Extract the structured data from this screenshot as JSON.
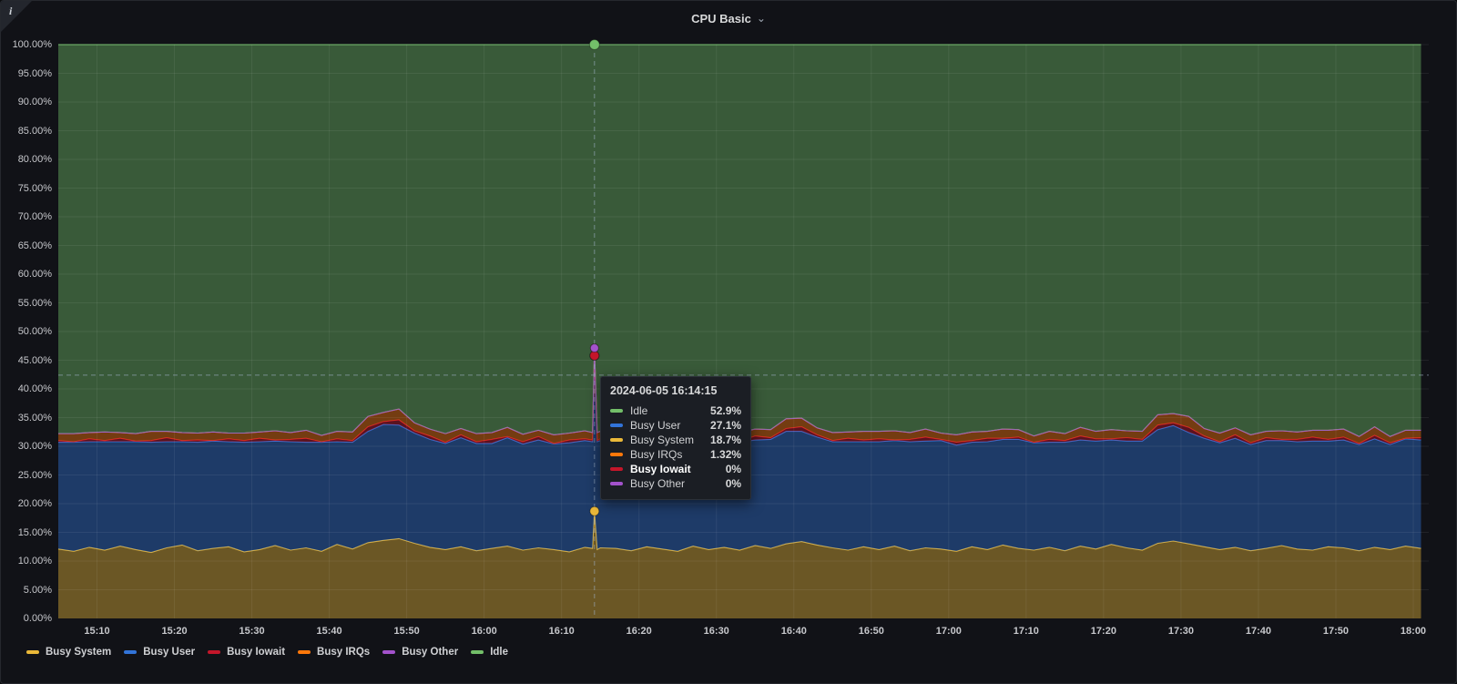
{
  "panel": {
    "title": "CPU Basic"
  },
  "icons": {
    "info": "i",
    "chevron_down": "⌄"
  },
  "colors": {
    "panel_bg": "#111217",
    "grid": "rgba(255,255,255,0.07)",
    "crosshair": "rgba(160,176,200,0.6)",
    "busy_system": "#EAB839",
    "busy_user": "#3274D9",
    "busy_iowait": "#C4162A",
    "busy_irqs": "#FF780A",
    "busy_other": "#A352CC",
    "idle": "#73BF69"
  },
  "tooltip": {
    "timestamp": "2024-06-05 16:14:15",
    "rows": [
      {
        "label": "Idle",
        "value": "52.9%",
        "color": "#73BF69",
        "bold": false
      },
      {
        "label": "Busy User",
        "value": "27.1%",
        "color": "#3274D9",
        "bold": false
      },
      {
        "label": "Busy System",
        "value": "18.7%",
        "color": "#EAB839",
        "bold": false
      },
      {
        "label": "Busy IRQs",
        "value": "1.32%",
        "color": "#FF780A",
        "bold": false
      },
      {
        "label": "Busy Iowait",
        "value": "0%",
        "color": "#C4162A",
        "bold": true
      },
      {
        "label": "Busy Other",
        "value": "0%",
        "color": "#A352CC",
        "bold": false
      }
    ]
  },
  "chart_data": {
    "type": "area",
    "stacked": true,
    "unit": "percent",
    "ylim": [
      0,
      100
    ],
    "grid": true,
    "legend_position": "bottom",
    "y_ticks": [
      "0.00%",
      "5.00%",
      "10.00%",
      "15.00%",
      "20.00%",
      "25.00%",
      "30.00%",
      "35.00%",
      "40.00%",
      "45.00%",
      "50.00%",
      "55.00%",
      "60.00%",
      "65.00%",
      "70.00%",
      "75.00%",
      "80.00%",
      "85.00%",
      "90.00%",
      "95.00%",
      "100.00%"
    ],
    "x_ticks": {
      "labels": [
        "15:10",
        "15:20",
        "15:30",
        "15:40",
        "15:50",
        "16:00",
        "16:10",
        "16:20",
        "16:30",
        "16:40",
        "16:50",
        "17:00",
        "17:10",
        "17:20",
        "17:30",
        "17:40",
        "17:50",
        "18:00"
      ],
      "first_min": 310,
      "step_min": 10
    },
    "x_window_min": [
      305,
      482
    ],
    "x_min": {
      "segments": [
        {
          "start": 305,
          "end": 373,
          "step": 2
        },
        {
          "explicit": [
            374,
            374.25,
            374.6,
            375
          ]
        },
        {
          "start": 377,
          "end": 481,
          "step": 2
        }
      ]
    },
    "hover": {
      "time_min": 374.25,
      "y_percent": 42.4
    },
    "series": [
      {
        "name": "Busy System",
        "color": "#EAB839",
        "values": [
          12.1,
          11.7,
          12.4,
          11.9,
          12.6,
          12.0,
          11.5,
          12.3,
          12.8,
          11.8,
          12.2,
          12.5,
          11.6,
          12.0,
          12.7,
          11.9,
          12.3,
          11.7,
          12.9,
          12.1,
          13.2,
          13.6,
          13.9,
          13.1,
          12.4,
          12.0,
          12.5,
          11.8,
          12.2,
          12.6,
          11.9,
          12.3,
          12.0,
          11.6,
          12.4,
          12.2,
          18.7,
          12.0,
          12.3,
          12.2,
          11.8,
          12.5,
          12.1,
          11.7,
          12.6,
          12.0,
          12.4,
          11.9,
          12.7,
          12.2,
          13.0,
          13.4,
          12.8,
          12.3,
          11.9,
          12.5,
          12.0,
          12.6,
          11.8,
          12.3,
          12.1,
          11.7,
          12.5,
          12.0,
          12.8,
          12.2,
          11.9,
          12.4,
          11.8,
          12.6,
          12.1,
          12.9,
          12.3,
          11.9,
          13.1,
          13.5,
          13.0,
          12.5,
          12.0,
          12.4,
          11.8,
          12.2,
          12.7,
          12.1,
          11.9,
          12.5,
          12.3,
          11.8,
          12.4,
          12.0,
          12.6,
          12.2
        ]
      },
      {
        "name": "Busy User",
        "color": "#3274D9",
        "values": [
          18.6,
          19.0,
          18.4,
          18.9,
          18.2,
          18.8,
          19.2,
          18.5,
          18.0,
          18.9,
          18.7,
          18.3,
          19.1,
          18.8,
          18.2,
          18.9,
          18.4,
          19.0,
          17.9,
          18.6,
          19.4,
          20.2,
          19.8,
          19.2,
          18.8,
          18.5,
          19.0,
          18.7,
          18.3,
          18.9,
          18.5,
          18.8,
          18.4,
          19.0,
          18.6,
          18.6,
          27.1,
          18.8,
          18.7,
          18.8,
          18.5,
          19.1,
          18.7,
          18.3,
          18.9,
          18.6,
          18.2,
          18.8,
          18.4,
          19.0,
          19.6,
          19.2,
          18.8,
          18.5,
          18.9,
          18.3,
          18.8,
          18.4,
          19.0,
          18.6,
          18.9,
          18.5,
          18.2,
          18.8,
          18.4,
          19.0,
          18.7,
          18.3,
          18.9,
          18.5,
          18.8,
          18.2,
          18.6,
          19.0,
          19.8,
          20.1,
          19.4,
          18.9,
          18.6,
          19.0,
          18.5,
          18.8,
          18.3,
          18.7,
          19.0,
          18.4,
          18.8,
          18.5,
          18.9,
          18.3,
          18.7,
          18.9
        ]
      },
      {
        "name": "Busy Iowait",
        "color": "#C4162A",
        "values": [
          0.3,
          0.1,
          0.5,
          0.2,
          0.6,
          0.1,
          0.3,
          0.7,
          0.2,
          0.4,
          0.1,
          0.5,
          0.3,
          0.6,
          0.2,
          0.4,
          0.7,
          0.1,
          0.5,
          0.3,
          0.8,
          0.5,
          0.9,
          0.4,
          0.6,
          0.2,
          0.5,
          0.3,
          0.7,
          0.2,
          0.4,
          0.6,
          0.1,
          0.5,
          0.3,
          0.3,
          0.0,
          0.2,
          0.3,
          0.4,
          0.6,
          0.2,
          0.5,
          0.3,
          0.1,
          0.6,
          0.4,
          0.2,
          0.7,
          0.3,
          0.5,
          0.8,
          0.4,
          0.2,
          0.6,
          0.3,
          0.5,
          0.1,
          0.4,
          0.7,
          0.2,
          0.5,
          0.3,
          0.6,
          0.2,
          0.4,
          0.1,
          0.5,
          0.3,
          0.7,
          0.4,
          0.2,
          0.6,
          0.3,
          0.8,
          0.5,
          0.9,
          0.4,
          0.2,
          0.6,
          0.3,
          0.5,
          0.2,
          0.4,
          0.7,
          0.3,
          0.5,
          0.2,
          0.6,
          0.3,
          0.1,
          0.4
        ]
      },
      {
        "name": "Busy IRQs",
        "color": "#FF780A",
        "values": [
          1.2,
          1.4,
          1.1,
          1.5,
          1.0,
          1.3,
          1.6,
          1.1,
          1.4,
          1.2,
          1.5,
          1.0,
          1.3,
          1.1,
          1.6,
          1.2,
          1.4,
          1.1,
          1.3,
          1.5,
          1.8,
          1.6,
          1.9,
          1.4,
          1.2,
          1.5,
          1.1,
          1.4,
          1.2,
          1.6,
          1.3,
          1.1,
          1.5,
          1.2,
          1.4,
          1.3,
          1.32,
          1.4,
          1.3,
          1.3,
          1.5,
          1.1,
          1.4,
          1.2,
          1.6,
          1.1,
          1.3,
          1.5,
          1.2,
          1.4,
          1.7,
          1.5,
          1.2,
          1.4,
          1.1,
          1.5,
          1.3,
          1.6,
          1.2,
          1.4,
          1.1,
          1.3,
          1.5,
          1.2,
          1.6,
          1.3,
          1.1,
          1.4,
          1.2,
          1.5,
          1.3,
          1.6,
          1.2,
          1.4,
          1.8,
          1.6,
          1.9,
          1.3,
          1.5,
          1.2,
          1.4,
          1.1,
          1.5,
          1.3,
          1.2,
          1.6,
          1.4,
          1.2,
          1.5,
          1.1,
          1.4,
          1.3
        ]
      },
      {
        "name": "Busy Other",
        "color": "#A352CC",
        "values": 0
      },
      {
        "name": "Idle",
        "color": "#73BF69",
        "values": "remainder"
      }
    ]
  }
}
